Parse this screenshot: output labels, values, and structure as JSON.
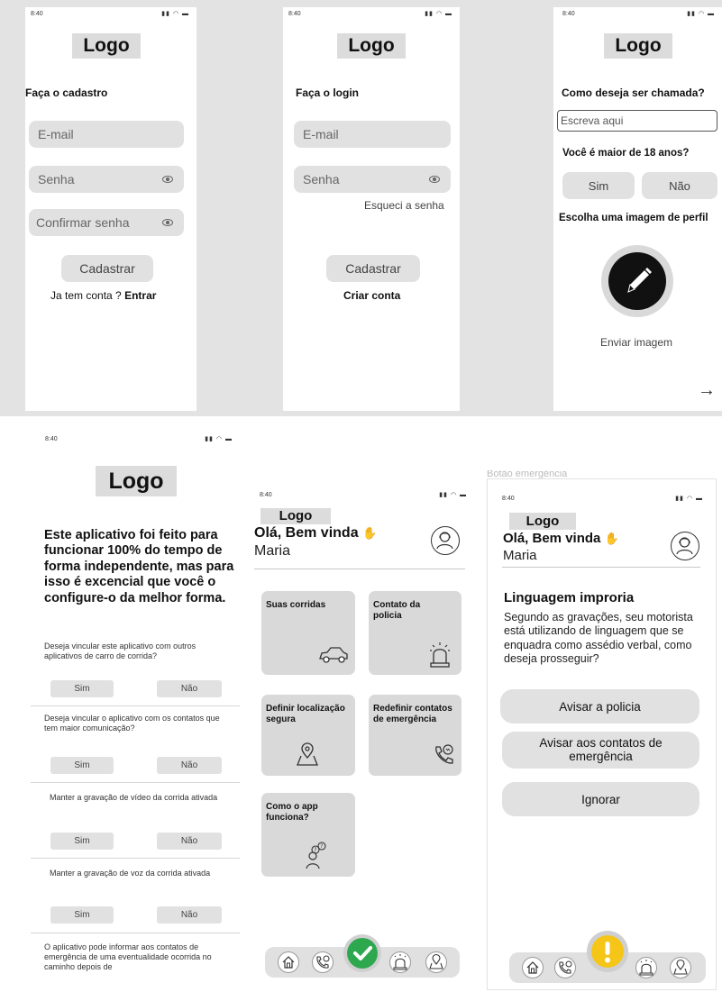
{
  "status_time": "8:40",
  "logo_text": "Logo",
  "signup": {
    "title": "Faça o cadastro",
    "email_placeholder": "E-mail",
    "password_placeholder": "Senha",
    "confirm_placeholder": "Confirmar senha",
    "submit_label": "Cadastrar",
    "have_account_text": "Ja tem conta ?",
    "login_link": "Entrar"
  },
  "login": {
    "title": "Faça o login",
    "email_placeholder": "E-mail",
    "password_placeholder": "Senha",
    "forgot_link": "Esqueci a senha",
    "submit_label": "Cadastrar",
    "create_account_link": "Criar conta"
  },
  "profile": {
    "name_question": "Como deseja ser chamada?",
    "name_placeholder": "Escreva aqui",
    "age_question": "Você é maior de 18 anos?",
    "yes_label": "Sim",
    "no_label": "Não",
    "image_question": "Escolha uma imagem de perfil",
    "upload_label": "Enviar imagem",
    "next_arrow": "→"
  },
  "setup": {
    "intro": "Este aplicativo foi feito para funcionar 100% do tempo de forma independente, mas para isso é excencial que você o configure-o da melhor forma.",
    "questions": [
      {
        "text": "Deseja vincular este aplicativo com outros aplicativos de carro de corrida?",
        "yes": "Sim",
        "no": "Não"
      },
      {
        "text": "Deseja vincular o aplicativo com os contatos que tem maior comunicação?",
        "yes": "Sim",
        "no": "Não"
      },
      {
        "text": "Manter a gravação de vídeo da corrida ativada",
        "yes": "Sim",
        "no": "Não"
      },
      {
        "text": "Manter a gravação de voz da corrida ativada",
        "yes": "Sim",
        "no": "Não"
      }
    ],
    "last_text": "O aplicativo pode informar aos contatos de emergência de uma eventualidade ocorrida no caminho depois de"
  },
  "home": {
    "greeting": "Olá, Bem vinda",
    "user_name": "Maria",
    "cards": [
      {
        "label": "Suas corridas",
        "icon": "car-icon"
      },
      {
        "label": "Contato da policia",
        "icon": "siren-icon"
      },
      {
        "label": "Definir localização segura",
        "icon": "map-pin-icon"
      },
      {
        "label": "Redefinir contatos de emergência",
        "icon": "phone-call-icon"
      },
      {
        "label": "Como o app funciona?",
        "icon": "question-person-icon"
      }
    ]
  },
  "alert": {
    "header_fragment": "Botão emergência",
    "greeting": "Olá, Bem vinda",
    "user_name": "Maria",
    "title": "Linguagem improria",
    "message": "Segundo as gravações, seu motorista está utilizando de linguagem que se enquadra como assédio verbal, como deseja prosseguir?",
    "actions": [
      "Avisar a policia",
      "Avisar aos contatos de emergência",
      "Ignorar"
    ]
  },
  "colors": {
    "check_green": "#2ea84f",
    "warning_yellow": "#f5c518",
    "dark_circle": "#111111"
  }
}
